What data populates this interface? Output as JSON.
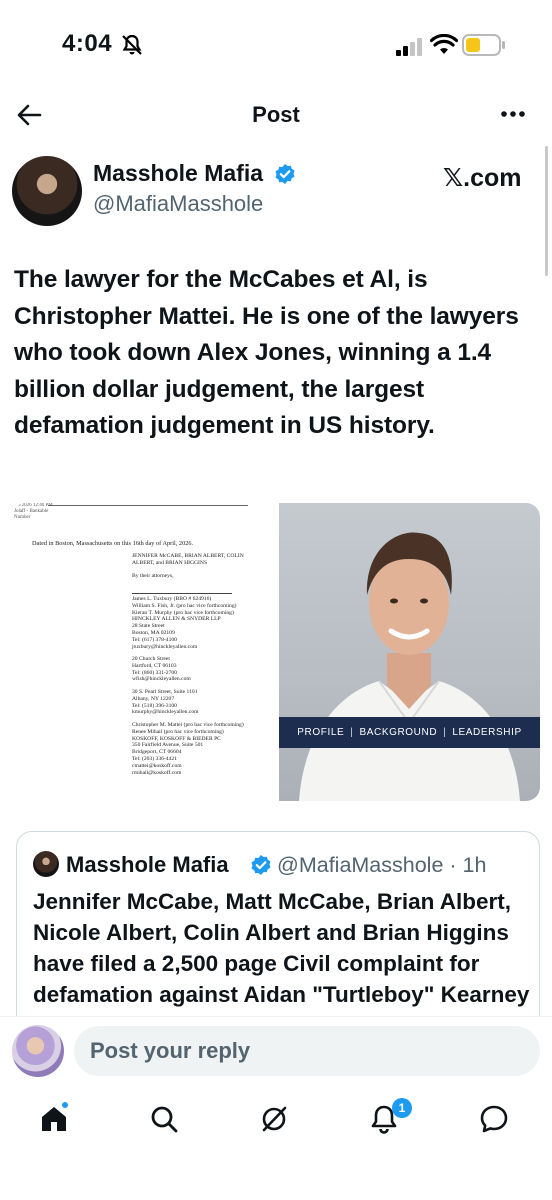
{
  "status_bar": {
    "time": "4:04"
  },
  "header": {
    "title": "Post"
  },
  "author": {
    "name": "Masshole Mafia",
    "handle": "@MafiaMasshole",
    "source": "𝕏.com"
  },
  "post": {
    "text": "The lawyer for the McCabes et Al, is Christopher Mattei. He is one of the lawyers who took down Alex Jones, winning a 1.4 billion dollar judgement, the largest defamation judgement in US history."
  },
  "media": {
    "document": {
      "header_lines": [
        "...6/2026 12:40 PM",
        "Jolaff - Bankable",
        "Number"
      ],
      "dated": "Dated in Boston, Massachusetts on this 16th day of April, 2026.",
      "plaintiffs": "JENNIFER McCABE, BRIAN ALBERT, COLIN\nALBERT, and BRIAN HIGGINS",
      "attorneys_label": "By their attorneys,",
      "block1": "James L. Tuxbury (BBO # 624916)\nWilliam S. Fish, Jr. (pro hac vice forthcoming)\nKieran T. Murphy (pro hac vice forthcoming)\nHINCKLEY ALLEN & SNYDER LLP\n28 State Street\nBoston, MA 02109\nTel: (617) 378-4100\njtuxbury@hinckleyallen.com",
      "block2": "20 Church Street\nHartford, CT 06103\nTel: (860) 331-2700\nwfish@hinckleyallen.com",
      "block3": "30 S. Pearl Street, Suite 1101\nAlbany, NY 12207\nTel: (518) 396-3100\nkmurphy@hinckleyallen.com",
      "block4": "Christopher M. Mattei (pro hac vice forthcoming)\nRenee Mihail (pro hac vice forthcoming)\nKOSKOFF, KOSKOFF & BIEDER PC\n350 Fairfield Avenue, Suite 501\nBridgeport, CT 06604\nTel: (203) 336-4421\ncmattei@koskoff.com\nrmihail@koskoff.com"
    },
    "photo_banner": [
      "PROFILE",
      "BACKGROUND",
      "LEADERSHIP"
    ]
  },
  "quote": {
    "name": "Masshole Mafia",
    "handle": "@MafiaMasshole",
    "time": "· 1h",
    "text": "Jennifer McCabe,  Matt McCabe,  Brian Albert, Nicole Albert, Colin Albert and Brian Higgins have filed a 2,500 page Civil complaint for defamation against Aidan \"Turtleboy\" Kearney and Karen Read..."
  },
  "reply": {
    "placeholder": "Post your reply"
  },
  "tabs": {
    "notifications_badge": "1",
    "icons": [
      "home-icon",
      "search-icon",
      "grok-icon",
      "notifications-icon",
      "messages-icon"
    ]
  },
  "colors": {
    "accent": "#1d9bf0",
    "banner": "#1c2d4f",
    "text": "#0f1419",
    "muted": "#536471"
  }
}
